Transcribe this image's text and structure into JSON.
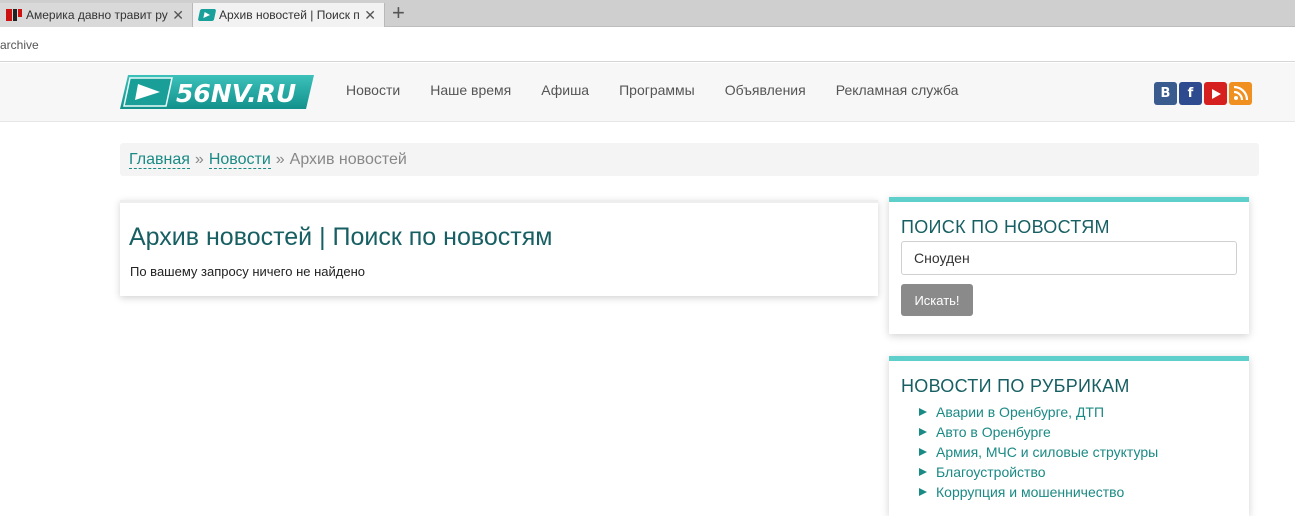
{
  "browser": {
    "tabs": [
      {
        "title": "Америка давно травит ру",
        "active": false,
        "icon": "news-favicon-icon"
      },
      {
        "title": "Архив новостей | Поиск п",
        "active": true,
        "icon": "56nv-favicon-icon"
      }
    ],
    "new_tab_symbol": "+",
    "close_symbol": "✕",
    "url": "archive"
  },
  "site": {
    "logo_text": "56NV.RU",
    "nav": [
      "Новости",
      "Наше время",
      "Афиша",
      "Программы",
      "Объявления",
      "Рекламная служба"
    ],
    "social": [
      {
        "name": "vk",
        "glyph": "B",
        "color": "#3a5b8d"
      },
      {
        "name": "facebook",
        "glyph": "f",
        "color": "#2d4b8e"
      },
      {
        "name": "youtube",
        "glyph": "▶",
        "color": "#d61f1f"
      },
      {
        "name": "rss",
        "glyph": "rss",
        "color": "#f09020"
      }
    ],
    "accent_color": "#1a8a85"
  },
  "breadcrumb": {
    "home": "Главная",
    "separator": "»",
    "news": "Новости",
    "current": "Архив новостей"
  },
  "main": {
    "title": "Архив новостей | Поиск по новостям",
    "message": "По вашему запросу ничего не найдено"
  },
  "sidebar": {
    "search": {
      "title": "ПОИСК ПО НОВОСТЯМ",
      "query": "Сноуден",
      "button": "Искать!"
    },
    "rubrics": {
      "title": "НОВОСТИ ПО РУБРИКАМ",
      "items": [
        "Аварии в Оренбурге, ДТП",
        "Авто в Оренбурге",
        "Армия, МЧС и силовые структуры",
        "Благоустройство",
        "Коррупция и мошенничество"
      ]
    }
  }
}
